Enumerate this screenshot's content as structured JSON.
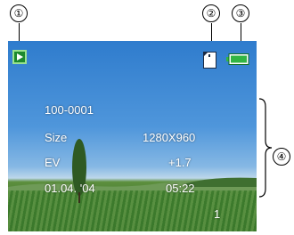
{
  "callouts": [
    "①",
    "②",
    "③",
    "④"
  ],
  "screen": {
    "file_number": "100-0001",
    "size_label": "Size",
    "size_value": "1280X960",
    "ev_label": "EV",
    "ev_value": "+1.7",
    "date": "01.04. '04",
    "time": "05:22",
    "count": "1"
  },
  "icons": {
    "mode": "play-icon",
    "media": "memory-card-icon",
    "battery": "battery-full-icon"
  },
  "colors": {
    "mode_icon_fill": "#1d8a2d",
    "battery_fill": "#31b543"
  }
}
